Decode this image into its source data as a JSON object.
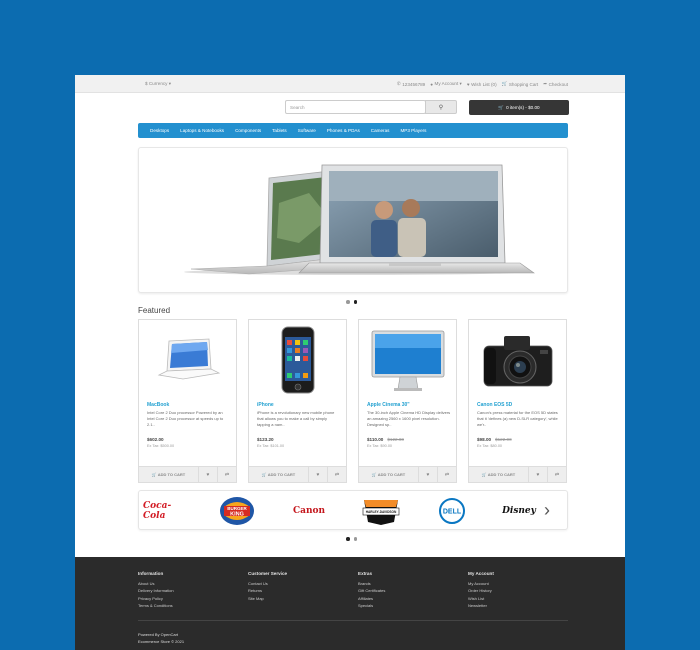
{
  "topbar": {
    "currency": "$ Currency ▾",
    "phone": "123456789",
    "my_account": "My Account ▾",
    "wishlist": "Wish List (0)",
    "shopping_cart": "Shopping Cart",
    "checkout": "Checkout"
  },
  "header": {
    "search_placeholder": "Search",
    "cart_label": "0 item(s) - $0.00"
  },
  "nav": {
    "items": [
      "Desktops",
      "Laptops & Notebooks",
      "Components",
      "Tablets",
      "Software",
      "Phones & PDAs",
      "Cameras",
      "MP3 Players"
    ]
  },
  "featured": {
    "title": "Featured",
    "add_to_cart": "ADD TO CART",
    "products": [
      {
        "name": "MacBook",
        "desc": "Intel Core 2 Duo processor Powered by an Intel Core 2 Duo processor at speeds up to 2.1..",
        "price": "$602.00",
        "old_price": "",
        "tax": "Ex Tax: $500.00"
      },
      {
        "name": "iPhone",
        "desc": "iPhone is a revolutionary new mobile phone that allows you to make a call by simply tapping a nam..",
        "price": "$123.20",
        "old_price": "",
        "tax": "Ex Tax: $101.00"
      },
      {
        "name": "Apple Cinema 30\"",
        "desc": "The 30-inch Apple Cinema HD Display delivers an amazing 2560 x 1600 pixel resolution. Designed sp..",
        "price": "$110.00",
        "old_price": "$122.00",
        "tax": "Ex Tax: $90.00"
      },
      {
        "name": "Canon EOS 5D",
        "desc": "Canon's press material for the EOS 5D states that it 'defines (a) new D-SLR category', while we'r..",
        "price": "$98.00",
        "old_price": "$122.00",
        "tax": "Ex Tax: $80.00"
      }
    ]
  },
  "brands": {
    "coca_cola": "Coca-Cola",
    "burger_king_top": "BURGER",
    "burger_king_bottom": "KING",
    "canon": "Canon",
    "harley_top": "HARLEY-DAVIDSON",
    "dell": "DELL",
    "disney": "Disney"
  },
  "footer": {
    "columns": [
      {
        "title": "Information",
        "links": [
          "About Us",
          "Delivery Information",
          "Privacy Policy",
          "Terms & Conditions"
        ]
      },
      {
        "title": "Customer Service",
        "links": [
          "Contact Us",
          "Returns",
          "Site Map"
        ]
      },
      {
        "title": "Extras",
        "links": [
          "Brands",
          "Gift Certificates",
          "Affiliates",
          "Specials"
        ]
      },
      {
        "title": "My Account",
        "links": [
          "My Account",
          "Order History",
          "Wish List",
          "Newsletter"
        ]
      }
    ],
    "powered_line1": "Powered By OpenCart",
    "powered_line2": "Ecommerce Store © 2021"
  },
  "colors": {
    "background": "#0c6cb0",
    "nav": "#2390cf",
    "link": "#23a1d1",
    "footer": "#2b2b2b",
    "cart": "#363636"
  }
}
